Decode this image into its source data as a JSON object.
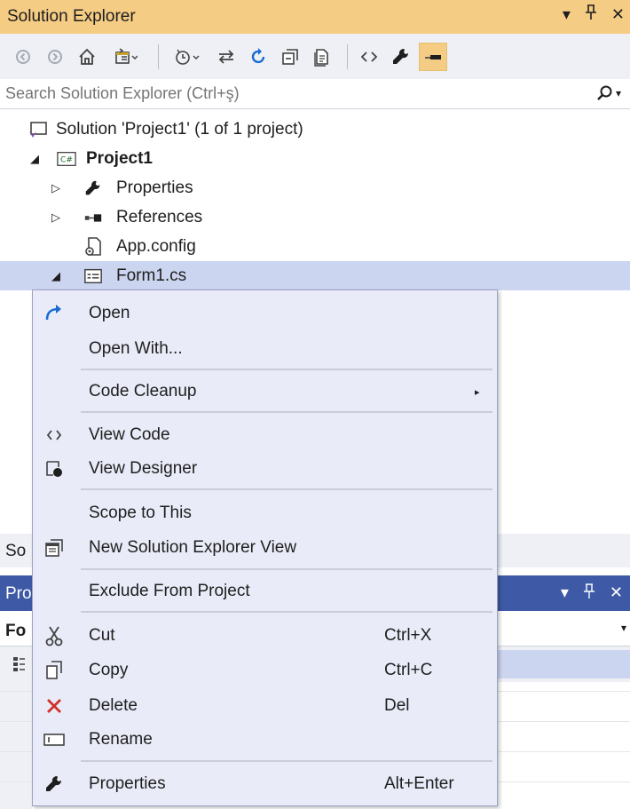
{
  "titlebar": {
    "title": "Solution Explorer",
    "dropdown_glyph": "▾",
    "pin_glyph": "⊥",
    "close_glyph": "✕"
  },
  "search": {
    "placeholder": "Search Solution Explorer (Ctrl+ş)",
    "dropdown_glyph": "▾"
  },
  "tree": {
    "items": [
      {
        "label": "Solution 'Project1' (1 of 1 project)",
        "icon": "solution-icon"
      },
      {
        "label": "Project1",
        "icon": "csharp-project-icon",
        "expanded": true
      },
      {
        "label": "Properties",
        "icon": "wrench-icon",
        "expanded": false
      },
      {
        "label": "References",
        "icon": "references-icon",
        "expanded": false
      },
      {
        "label": "App.config",
        "icon": "config-file-icon"
      },
      {
        "label": "Form1.cs",
        "icon": "form-icon",
        "expanded": true,
        "selected": true
      }
    ],
    "expanded_glyph": "◢",
    "collapsed_glyph": "▷"
  },
  "lower": {
    "tab_text": "So",
    "props_title": "Pro",
    "props_object": "Fo",
    "props_dropdown_glyph": "▾",
    "props_pin_glyph": "⊥",
    "props_close_glyph": "✕",
    "props_menu_glyph": "▾"
  },
  "menu": {
    "items": [
      {
        "label": "Open",
        "icon": "open-arrow-icon",
        "shortcut": ""
      },
      {
        "label": "Open With...",
        "icon": "",
        "shortcut": ""
      },
      {
        "label": "Code Cleanup",
        "icon": "",
        "shortcut": "",
        "submenu": "▸"
      },
      {
        "label": "View Code",
        "icon": "code-brackets-icon",
        "shortcut": ""
      },
      {
        "label": "View Designer",
        "icon": "designer-icon",
        "shortcut": ""
      },
      {
        "label": "Scope to This",
        "icon": "",
        "shortcut": ""
      },
      {
        "label": "New Solution Explorer View",
        "icon": "new-view-icon",
        "shortcut": ""
      },
      {
        "label": "Exclude From Project",
        "icon": "",
        "shortcut": ""
      },
      {
        "label": "Cut",
        "icon": "scissors-icon",
        "shortcut": "Ctrl+X"
      },
      {
        "label": "Copy",
        "icon": "copy-icon",
        "shortcut": "Ctrl+C"
      },
      {
        "label": "Delete",
        "icon": "delete-x-icon",
        "shortcut": "Del"
      },
      {
        "label": "Rename",
        "icon": "rename-icon",
        "shortcut": ""
      },
      {
        "label": "Properties",
        "icon": "wrench-icon",
        "shortcut": "Alt+Enter"
      }
    ]
  },
  "colors": {
    "title_bar": "#f5cc84",
    "toolbar": "#eef0f5",
    "selection": "#ccd5f0",
    "menu_bg": "#e9ecf8",
    "props_header": "#3e59a6",
    "open_icon": "#1a6bd4",
    "delete_icon": "#d0312d"
  }
}
